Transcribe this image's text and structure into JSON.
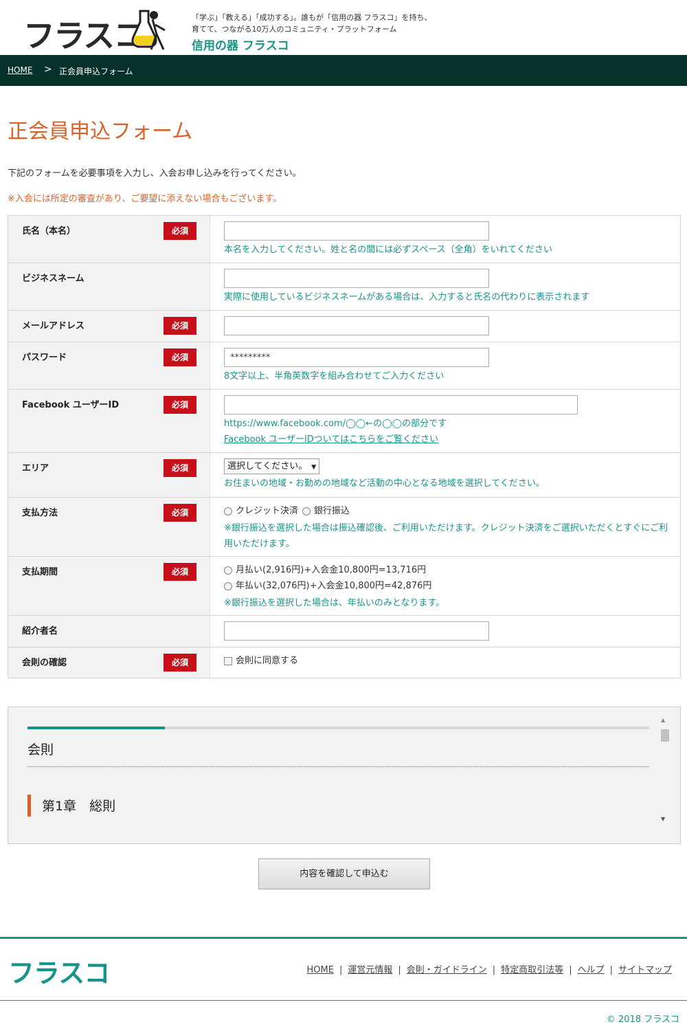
{
  "header": {
    "logo": "フラスコ",
    "tagline": "「学ぶ」「教える」「成功する」。誰もが「信用の器 フラスコ」を持ち、育てて、つながる10万人のコミュニティ・プラットフォーム",
    "brand": "信用の器 フラスコ"
  },
  "breadcrumb": {
    "home": "HOME",
    "separator": ">",
    "current": "正会員申込フォーム"
  },
  "page": {
    "title": "正会員申込フォーム",
    "intro": "下記のフォームを必要事項を入力し、入会お申し込みを行ってください。",
    "notice": "※入会には所定の審査があり、ご要望に添えない場合もございます。"
  },
  "required_label": "必須",
  "form": {
    "name": {
      "label": "氏名（本名）",
      "hint": "本名を入力してください。姓と名の間には必ずスペース（全角）をいれてください"
    },
    "business_name": {
      "label": "ビジネスネーム",
      "hint": "実際に使用しているビジネスネームがある場合は、入力すると氏名の代わりに表示されます"
    },
    "email": {
      "label": "メールアドレス"
    },
    "password": {
      "label": "パスワード",
      "value": "*********",
      "hint": "8文字以上、半角英数字を組み合わせてご入力ください"
    },
    "facebook": {
      "label": "Facebook ユーザーID",
      "hint": "https://www.facebook.com/◯◯←の◯◯の部分です",
      "link": "Facebook ユーザーIDついてはこちらをご覧ください"
    },
    "area": {
      "label": "エリア",
      "selected": "選択してください。",
      "hint": "お住まいの地域・お勤めの地域など活動の中心となる地域を選択してください。"
    },
    "payment_method": {
      "label": "支払方法",
      "options": [
        "クレジット決済",
        "銀行振込"
      ],
      "hint": "※銀行振込を選択した場合は振込確認後、ご利用いただけます。クレジット決済をご選択いただくとすぐにご利用いただけます。"
    },
    "payment_period": {
      "label": "支払期間",
      "options": [
        "月払い(2,916円)+入会金10,800円=13,716円",
        "年払い(32,076円)+入会金10,800円=42,876円"
      ],
      "hint": "※銀行振込を選択した場合は、年払いのみとなります。"
    },
    "referrer": {
      "label": "紹介者名"
    },
    "rules_confirm": {
      "label": "会則の確認",
      "checkbox": "会則に同意する"
    }
  },
  "rules": {
    "title": "会則",
    "chapter": "第1章　総則"
  },
  "submit_label": "内容を確認して申込む",
  "footer": {
    "logo": "フラスコ",
    "nav": [
      "HOME",
      "運営元情報",
      "会則・ガイドライン",
      "特定商取引法等",
      "ヘルプ",
      "サイトマップ"
    ],
    "copyright": "© 2018 フラスコ"
  },
  "colors": {
    "accent": "#17938a",
    "orange": "#d9622b",
    "required": "#c8101a",
    "nav_bg": "#06302a"
  }
}
